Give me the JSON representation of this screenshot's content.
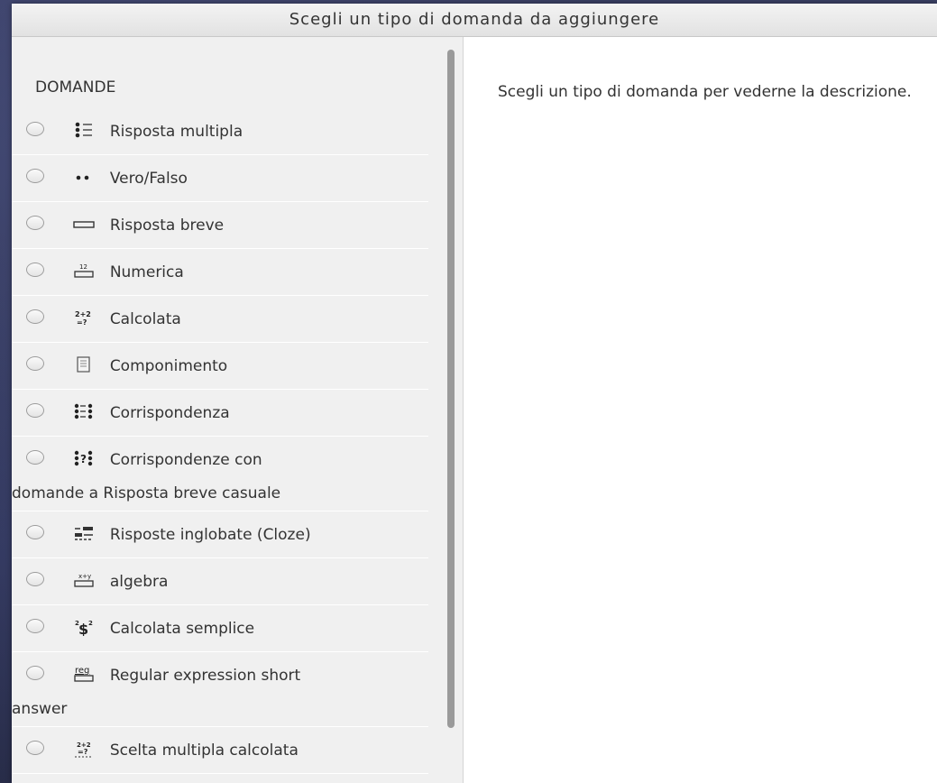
{
  "dialog": {
    "title": "Scegli un tipo di domanda da aggiungere",
    "section_title": "DOMANDE",
    "description": "Scegli un tipo di domanda per vederne la descrizione."
  },
  "question_types": [
    {
      "label": "Risposta multipla",
      "icon": "multichoice-icon"
    },
    {
      "label": "Vero/Falso",
      "icon": "truefalse-icon"
    },
    {
      "label": "Risposta breve",
      "icon": "shortanswer-icon"
    },
    {
      "label": "Numerica",
      "icon": "numerical-icon"
    },
    {
      "label": "Calcolata",
      "icon": "calculated-icon"
    },
    {
      "label": "Componimento",
      "icon": "essay-icon"
    },
    {
      "label": "Corrispondenza",
      "icon": "match-icon"
    },
    {
      "label": "Corrispondenze con",
      "label_cont": "domande a Risposta breve casuale",
      "icon": "randomsamatch-icon"
    },
    {
      "label": "Risposte inglobate (Cloze)",
      "icon": "multianswer-icon"
    },
    {
      "label": "algebra",
      "icon": "algebra-icon"
    },
    {
      "label": "Calcolata semplice",
      "icon": "calculatedsimple-icon"
    },
    {
      "label": "Regular expression short",
      "label_cont": "answer",
      "icon": "regexp-icon"
    },
    {
      "label": "Scelta multipla calcolata",
      "icon": "calculatedmulti-icon"
    }
  ]
}
